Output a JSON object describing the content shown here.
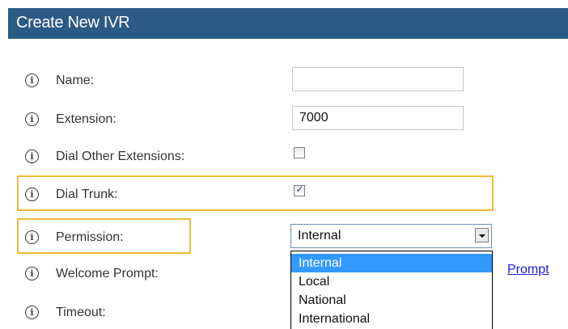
{
  "header": {
    "title": "Create New IVR"
  },
  "fields": {
    "name": {
      "label": "Name:",
      "value": ""
    },
    "extension": {
      "label": "Extension:",
      "value": "7000"
    },
    "dial_other_extensions": {
      "label": "Dial Other Extensions:",
      "checked": false
    },
    "dial_trunk": {
      "label": "Dial Trunk:",
      "checked": true
    },
    "permission": {
      "label": "Permission:",
      "selected": "Internal",
      "options": [
        "Internal",
        "Local",
        "National",
        "International"
      ]
    },
    "welcome_prompt": {
      "label": "Welcome Prompt:",
      "link_text": "Prompt"
    },
    "timeout": {
      "label": "Timeout:"
    }
  },
  "colors": {
    "header_bg": "#2c5a86",
    "highlight_border": "#f2bb33",
    "selected_option_bg": "#3399ff",
    "link": "#1a1adb"
  },
  "icons": {
    "info": "info-circle-icon",
    "dropdown_arrow": "chevron-down-icon"
  },
  "glyphs": {
    "info": "i",
    "check": "✓"
  }
}
